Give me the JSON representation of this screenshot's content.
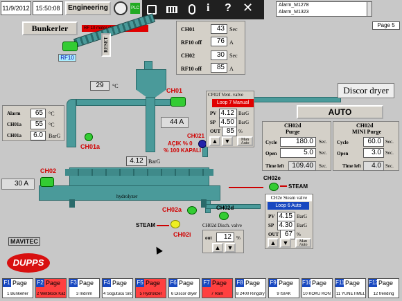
{
  "header": {
    "date": "11/9/2012",
    "time": "15:50:08",
    "user_button": "Engineering",
    "alarm_lines": [
      "Alarm_M1278",
      "Alarm_M1323"
    ],
    "page_label": "Page 5"
  },
  "overlay_toolbar": {
    "icons": [
      "grid-icon",
      "keyboard-icon",
      "mouse-icon",
      "info-icon",
      "question-icon",
      "close-icon"
    ]
  },
  "bunker": {
    "title": "Bunkerler",
    "status_bar": "RF 10 motor status",
    "reset_label": "RESET",
    "rf_label": "RF10"
  },
  "ch_table": {
    "rows": [
      {
        "label": "CH01",
        "value": "43",
        "unit": "Sec"
      },
      {
        "label": "RF10 off",
        "value": "76",
        "unit": "A"
      },
      {
        "label": "CH02",
        "value": "30",
        "unit": "Sec"
      },
      {
        "label": "RF10 off",
        "value": "85",
        "unit": "A"
      }
    ]
  },
  "temp_top": {
    "value": "29",
    "unit": "°C"
  },
  "ch01_label": "CH01",
  "ch01_amps": {
    "value": "44",
    "unit": "A"
  },
  "ch01a_label": "CH01a",
  "alarm_panel": {
    "rows": [
      {
        "label": "Alarm",
        "value": "65",
        "unit": "°C"
      },
      {
        "label": "CH01a",
        "value": "55",
        "unit": "°C"
      },
      {
        "label": "CH01a",
        "value": "6.0",
        "unit": "BarG"
      }
    ]
  },
  "ch02_label": "CH02",
  "ch02_amps": {
    "value": "30",
    "unit": "A"
  },
  "hydrolyzer": {
    "pressure": "4.12",
    "unit": "BarG",
    "name": "hydrolyzer"
  },
  "ch021": {
    "label": "CH021",
    "open_text": "AÇIK % 0",
    "closed_text": "% 100 KAPALI"
  },
  "vent_valve": {
    "title": "CF02f Vent. valve",
    "loop": "Loop 7 Manual",
    "pv": "4.12",
    "pv_unit": "BarG",
    "sp": "4.50",
    "sp_unit": "BarG",
    "out": "85",
    "out_unit": "%",
    "manauto": "Man Auto"
  },
  "discor": {
    "title": "Discor dryer",
    "auto_button": "AUTO",
    "purge": {
      "title1": "CH02d",
      "title2": "Purge",
      "cycle_label": "Cycle",
      "cycle": "180.0",
      "cycle_unit": "Sec.",
      "open_label": "Open",
      "open": "5.0",
      "open_unit": "Sec.",
      "timeleft_label": "Time left",
      "timeleft": "109.40",
      "timeleft_unit": "Sec."
    },
    "mini_purge": {
      "title1": "CH02d",
      "title2": "MINI Purge",
      "cycle": "60.0",
      "cycle_unit": "Sec.",
      "open": "3.0",
      "open_unit": "Sec.",
      "timeleft_label": "Time left",
      "timeleft": "4.0",
      "timeleft_unit": "Sec."
    }
  },
  "ch02e": {
    "label": "CH02e",
    "steam": "STEAM"
  },
  "steam_valve": {
    "title": "CH2e Steam valve",
    "loop": "Loop 6 Auto",
    "pv": "4.15",
    "pv_unit": "BarG",
    "sp": "4.30",
    "sp_unit": "BarG",
    "out": "67",
    "out_unit": "%",
    "manauto": "Man Auto"
  },
  "ch02d": {
    "label": "CH02d",
    "disch_title": "CH02d Disch. valve",
    "out_label": "out",
    "out": "12",
    "out_unit": "%"
  },
  "ch02a_label": "CH02a",
  "ch02i_label": "CH02i",
  "steam_left": "STEAM",
  "logos": {
    "mavitec": "MAVITEC",
    "dupps": "DUPPS"
  },
  "fkeys": [
    {
      "key": "F1",
      "page": "Page",
      "num": "1",
      "sub": "Bunkerler",
      "red": false
    },
    {
      "key": "F2",
      "page": "Page",
      "num": "2",
      "sub": "Wetblock Kazanı",
      "red": true
    },
    {
      "key": "F3",
      "page": "Page",
      "num": "3",
      "sub": "İndirim",
      "red": false
    },
    {
      "key": "F4",
      "page": "Page",
      "num": "4",
      "sub": "Sogutucu Siloları",
      "red": false
    },
    {
      "key": "F5",
      "page": "Page",
      "num": "5",
      "sub": "Hydrolizer",
      "red": true
    },
    {
      "key": "F6",
      "page": "Page",
      "num": "6",
      "sub": "Discor dryer",
      "red": false
    },
    {
      "key": "F7",
      "page": "Page",
      "num": "7",
      "sub": "Ram",
      "red": true
    },
    {
      "key": "F8",
      "page": "Page",
      "num": "8",
      "sub": "2400 Ringdryer",
      "red": false
    },
    {
      "key": "F9",
      "page": "Page",
      "num": "9",
      "sub": "ISIAK",
      "red": false
    },
    {
      "key": "F10",
      "page": "Page",
      "num": "10",
      "sub": "KOKU KONTROL",
      "red": false
    },
    {
      "key": "F11",
      "page": "Page",
      "num": "11",
      "sub": "YÜNETİMELİK",
      "red": false
    },
    {
      "key": "F12",
      "page": "Page",
      "num": "12",
      "sub": "trending",
      "red": false
    }
  ]
}
